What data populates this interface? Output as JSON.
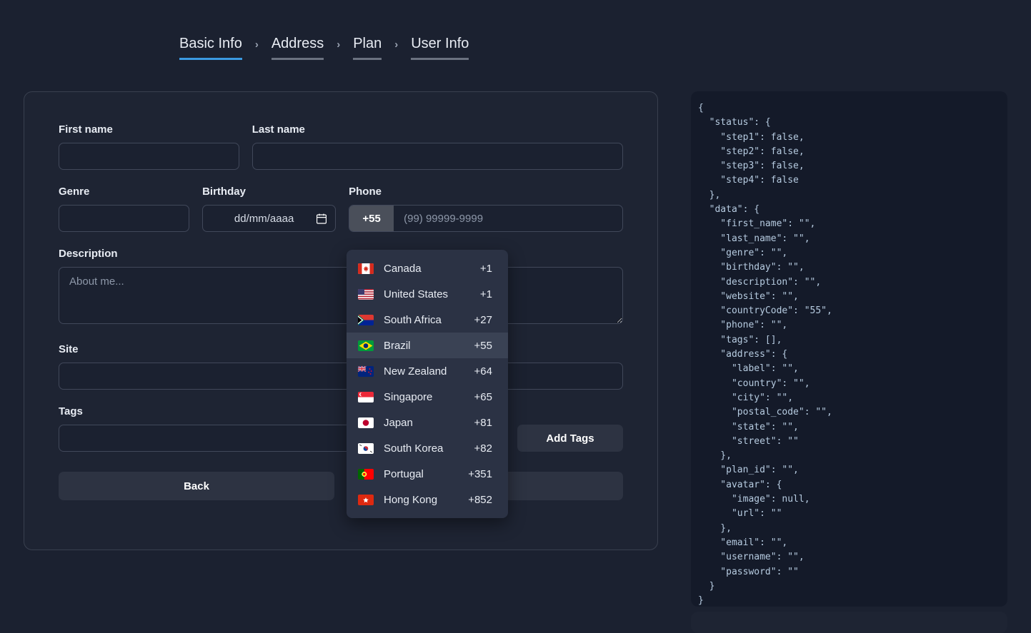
{
  "steps": [
    {
      "label": "Basic Info",
      "active": true
    },
    {
      "label": "Address",
      "active": false
    },
    {
      "label": "Plan",
      "active": false
    },
    {
      "label": "User Info",
      "active": false
    }
  ],
  "separator": "›",
  "form": {
    "first_name": {
      "label": "First name",
      "value": "",
      "placeholder": ""
    },
    "last_name": {
      "label": "Last name",
      "value": "",
      "placeholder": ""
    },
    "genre": {
      "label": "Genre",
      "value": "",
      "placeholder": ""
    },
    "birthday": {
      "label": "Birthday",
      "value": "",
      "placeholder": "dd/mm/aaaa"
    },
    "phone": {
      "label": "Phone",
      "country_code": "+55",
      "value": "",
      "placeholder": "(99) 99999-9999"
    },
    "description": {
      "label": "Description",
      "value": "",
      "placeholder": "About me..."
    },
    "site": {
      "label": "Site",
      "value": "",
      "placeholder": ""
    },
    "tags": {
      "label": "Tags",
      "value": "",
      "placeholder": ""
    },
    "add_tags_label": "Add Tags",
    "back_label": "Back",
    "next_label": ""
  },
  "country_dropdown": {
    "selected": "Brazil",
    "items": [
      {
        "name": "Canada",
        "code": "+1",
        "flag": "ca"
      },
      {
        "name": "United States",
        "code": "+1",
        "flag": "us"
      },
      {
        "name": "South Africa",
        "code": "+27",
        "flag": "za"
      },
      {
        "name": "Brazil",
        "code": "+55",
        "flag": "br"
      },
      {
        "name": "New Zealand",
        "code": "+64",
        "flag": "nz"
      },
      {
        "name": "Singapore",
        "code": "+65",
        "flag": "sg"
      },
      {
        "name": "Japan",
        "code": "+81",
        "flag": "jp"
      },
      {
        "name": "South Korea",
        "code": "+82",
        "flag": "kr"
      },
      {
        "name": "Portugal",
        "code": "+351",
        "flag": "pt"
      },
      {
        "name": "Hong Kong",
        "code": "+852",
        "flag": "hk"
      }
    ]
  },
  "debug_json": "{\n  \"status\": {\n    \"step1\": false,\n    \"step2\": false,\n    \"step3\": false,\n    \"step4\": false\n  },\n  \"data\": {\n    \"first_name\": \"\",\n    \"last_name\": \"\",\n    \"genre\": \"\",\n    \"birthday\": \"\",\n    \"description\": \"\",\n    \"website\": \"\",\n    \"countryCode\": \"55\",\n    \"phone\": \"\",\n    \"tags\": [],\n    \"address\": {\n      \"label\": \"\",\n      \"country\": \"\",\n      \"city\": \"\",\n      \"postal_code\": \"\",\n      \"state\": \"\",\n      \"street\": \"\"\n    },\n    \"plan_id\": \"\",\n    \"avatar\": {\n      \"image\": null,\n      \"url\": \"\"\n    },\n    \"email\": \"\",\n    \"username\": \"\",\n    \"password\": \"\"\n  }\n}",
  "colors": {
    "page_bg": "#1b2130",
    "card_bg": "#1e2433",
    "accent": "#3b9ae1",
    "json_bg": "#141a29",
    "json_text": "#b6cbe0",
    "dropdown_bg": "#2b3244",
    "dropdown_selected": "#3a4254",
    "button_bg": "#2d3342",
    "cc_bg": "#4a4f5a"
  }
}
